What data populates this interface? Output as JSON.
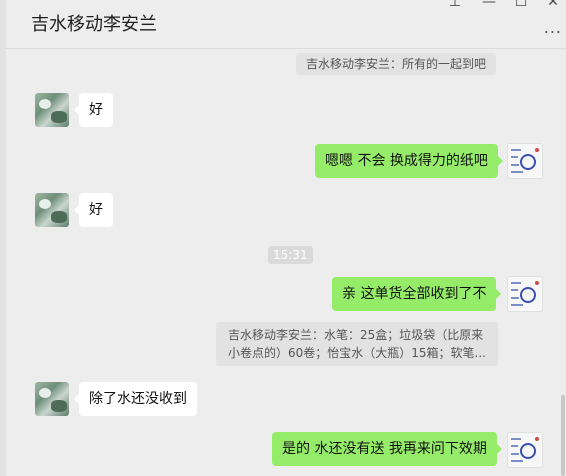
{
  "header": {
    "title": "吉水移动李安兰",
    "more_label": "..."
  },
  "window_controls": {
    "pin": "⊥",
    "minimize": "—",
    "maximize": "☐",
    "close": "✕"
  },
  "messages": {
    "quote_top": "吉水移动李安兰：所有的一起到吧",
    "in_1": "好",
    "out_1": "嗯嗯 不会 换成得力的纸吧",
    "in_2": "好",
    "timestamp": "15:31",
    "out_2": "亲 这单货全部收到了不",
    "quote_line1": "吉水移动李安兰：水笔：25盒；垃圾袋（比原来",
    "quote_line2": "小卷点的）60卷；怡宝水（大瓶）15箱；软笔...",
    "in_3": "除了水还没收到",
    "out_3": "是的 水还没有送 我再来问下效期"
  },
  "colors": {
    "background": "#ededed",
    "outgoing_bubble": "#95ec69",
    "incoming_bubble": "#ffffff",
    "quote_bg": "#e2e2e2"
  }
}
